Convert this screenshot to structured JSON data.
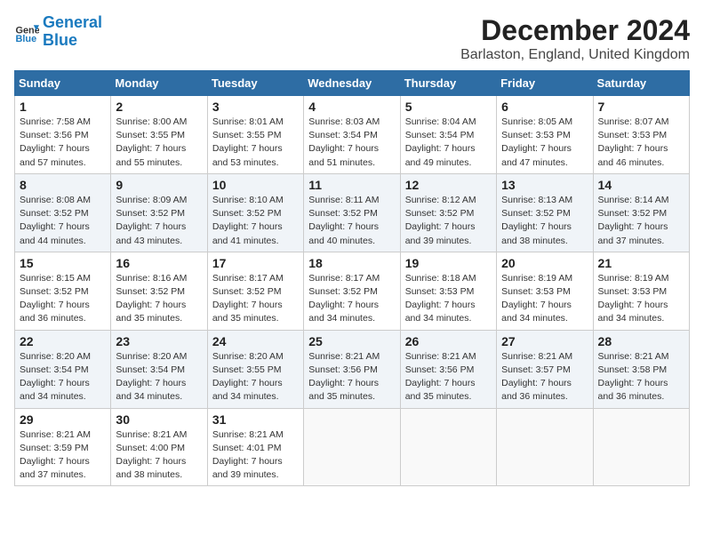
{
  "header": {
    "logo_line1": "General",
    "logo_line2": "Blue",
    "title": "December 2024",
    "subtitle": "Barlaston, England, United Kingdom"
  },
  "days_of_week": [
    "Sunday",
    "Monday",
    "Tuesday",
    "Wednesday",
    "Thursday",
    "Friday",
    "Saturday"
  ],
  "weeks": [
    [
      {
        "day": "1",
        "sunrise": "7:58 AM",
        "sunset": "3:56 PM",
        "daylight": "7 hours and 57 minutes."
      },
      {
        "day": "2",
        "sunrise": "8:00 AM",
        "sunset": "3:55 PM",
        "daylight": "7 hours and 55 minutes."
      },
      {
        "day": "3",
        "sunrise": "8:01 AM",
        "sunset": "3:55 PM",
        "daylight": "7 hours and 53 minutes."
      },
      {
        "day": "4",
        "sunrise": "8:03 AM",
        "sunset": "3:54 PM",
        "daylight": "7 hours and 51 minutes."
      },
      {
        "day": "5",
        "sunrise": "8:04 AM",
        "sunset": "3:54 PM",
        "daylight": "7 hours and 49 minutes."
      },
      {
        "day": "6",
        "sunrise": "8:05 AM",
        "sunset": "3:53 PM",
        "daylight": "7 hours and 47 minutes."
      },
      {
        "day": "7",
        "sunrise": "8:07 AM",
        "sunset": "3:53 PM",
        "daylight": "7 hours and 46 minutes."
      }
    ],
    [
      {
        "day": "8",
        "sunrise": "8:08 AM",
        "sunset": "3:52 PM",
        "daylight": "7 hours and 44 minutes."
      },
      {
        "day": "9",
        "sunrise": "8:09 AM",
        "sunset": "3:52 PM",
        "daylight": "7 hours and 43 minutes."
      },
      {
        "day": "10",
        "sunrise": "8:10 AM",
        "sunset": "3:52 PM",
        "daylight": "7 hours and 41 minutes."
      },
      {
        "day": "11",
        "sunrise": "8:11 AM",
        "sunset": "3:52 PM",
        "daylight": "7 hours and 40 minutes."
      },
      {
        "day": "12",
        "sunrise": "8:12 AM",
        "sunset": "3:52 PM",
        "daylight": "7 hours and 39 minutes."
      },
      {
        "day": "13",
        "sunrise": "8:13 AM",
        "sunset": "3:52 PM",
        "daylight": "7 hours and 38 minutes."
      },
      {
        "day": "14",
        "sunrise": "8:14 AM",
        "sunset": "3:52 PM",
        "daylight": "7 hours and 37 minutes."
      }
    ],
    [
      {
        "day": "15",
        "sunrise": "8:15 AM",
        "sunset": "3:52 PM",
        "daylight": "7 hours and 36 minutes."
      },
      {
        "day": "16",
        "sunrise": "8:16 AM",
        "sunset": "3:52 PM",
        "daylight": "7 hours and 35 minutes."
      },
      {
        "day": "17",
        "sunrise": "8:17 AM",
        "sunset": "3:52 PM",
        "daylight": "7 hours and 35 minutes."
      },
      {
        "day": "18",
        "sunrise": "8:17 AM",
        "sunset": "3:52 PM",
        "daylight": "7 hours and 34 minutes."
      },
      {
        "day": "19",
        "sunrise": "8:18 AM",
        "sunset": "3:53 PM",
        "daylight": "7 hours and 34 minutes."
      },
      {
        "day": "20",
        "sunrise": "8:19 AM",
        "sunset": "3:53 PM",
        "daylight": "7 hours and 34 minutes."
      },
      {
        "day": "21",
        "sunrise": "8:19 AM",
        "sunset": "3:53 PM",
        "daylight": "7 hours and 34 minutes."
      }
    ],
    [
      {
        "day": "22",
        "sunrise": "8:20 AM",
        "sunset": "3:54 PM",
        "daylight": "7 hours and 34 minutes."
      },
      {
        "day": "23",
        "sunrise": "8:20 AM",
        "sunset": "3:54 PM",
        "daylight": "7 hours and 34 minutes."
      },
      {
        "day": "24",
        "sunrise": "8:20 AM",
        "sunset": "3:55 PM",
        "daylight": "7 hours and 34 minutes."
      },
      {
        "day": "25",
        "sunrise": "8:21 AM",
        "sunset": "3:56 PM",
        "daylight": "7 hours and 35 minutes."
      },
      {
        "day": "26",
        "sunrise": "8:21 AM",
        "sunset": "3:56 PM",
        "daylight": "7 hours and 35 minutes."
      },
      {
        "day": "27",
        "sunrise": "8:21 AM",
        "sunset": "3:57 PM",
        "daylight": "7 hours and 36 minutes."
      },
      {
        "day": "28",
        "sunrise": "8:21 AM",
        "sunset": "3:58 PM",
        "daylight": "7 hours and 36 minutes."
      }
    ],
    [
      {
        "day": "29",
        "sunrise": "8:21 AM",
        "sunset": "3:59 PM",
        "daylight": "7 hours and 37 minutes."
      },
      {
        "day": "30",
        "sunrise": "8:21 AM",
        "sunset": "4:00 PM",
        "daylight": "7 hours and 38 minutes."
      },
      {
        "day": "31",
        "sunrise": "8:21 AM",
        "sunset": "4:01 PM",
        "daylight": "7 hours and 39 minutes."
      },
      null,
      null,
      null,
      null
    ]
  ],
  "labels": {
    "sunrise": "Sunrise:",
    "sunset": "Sunset:",
    "daylight": "Daylight:"
  }
}
